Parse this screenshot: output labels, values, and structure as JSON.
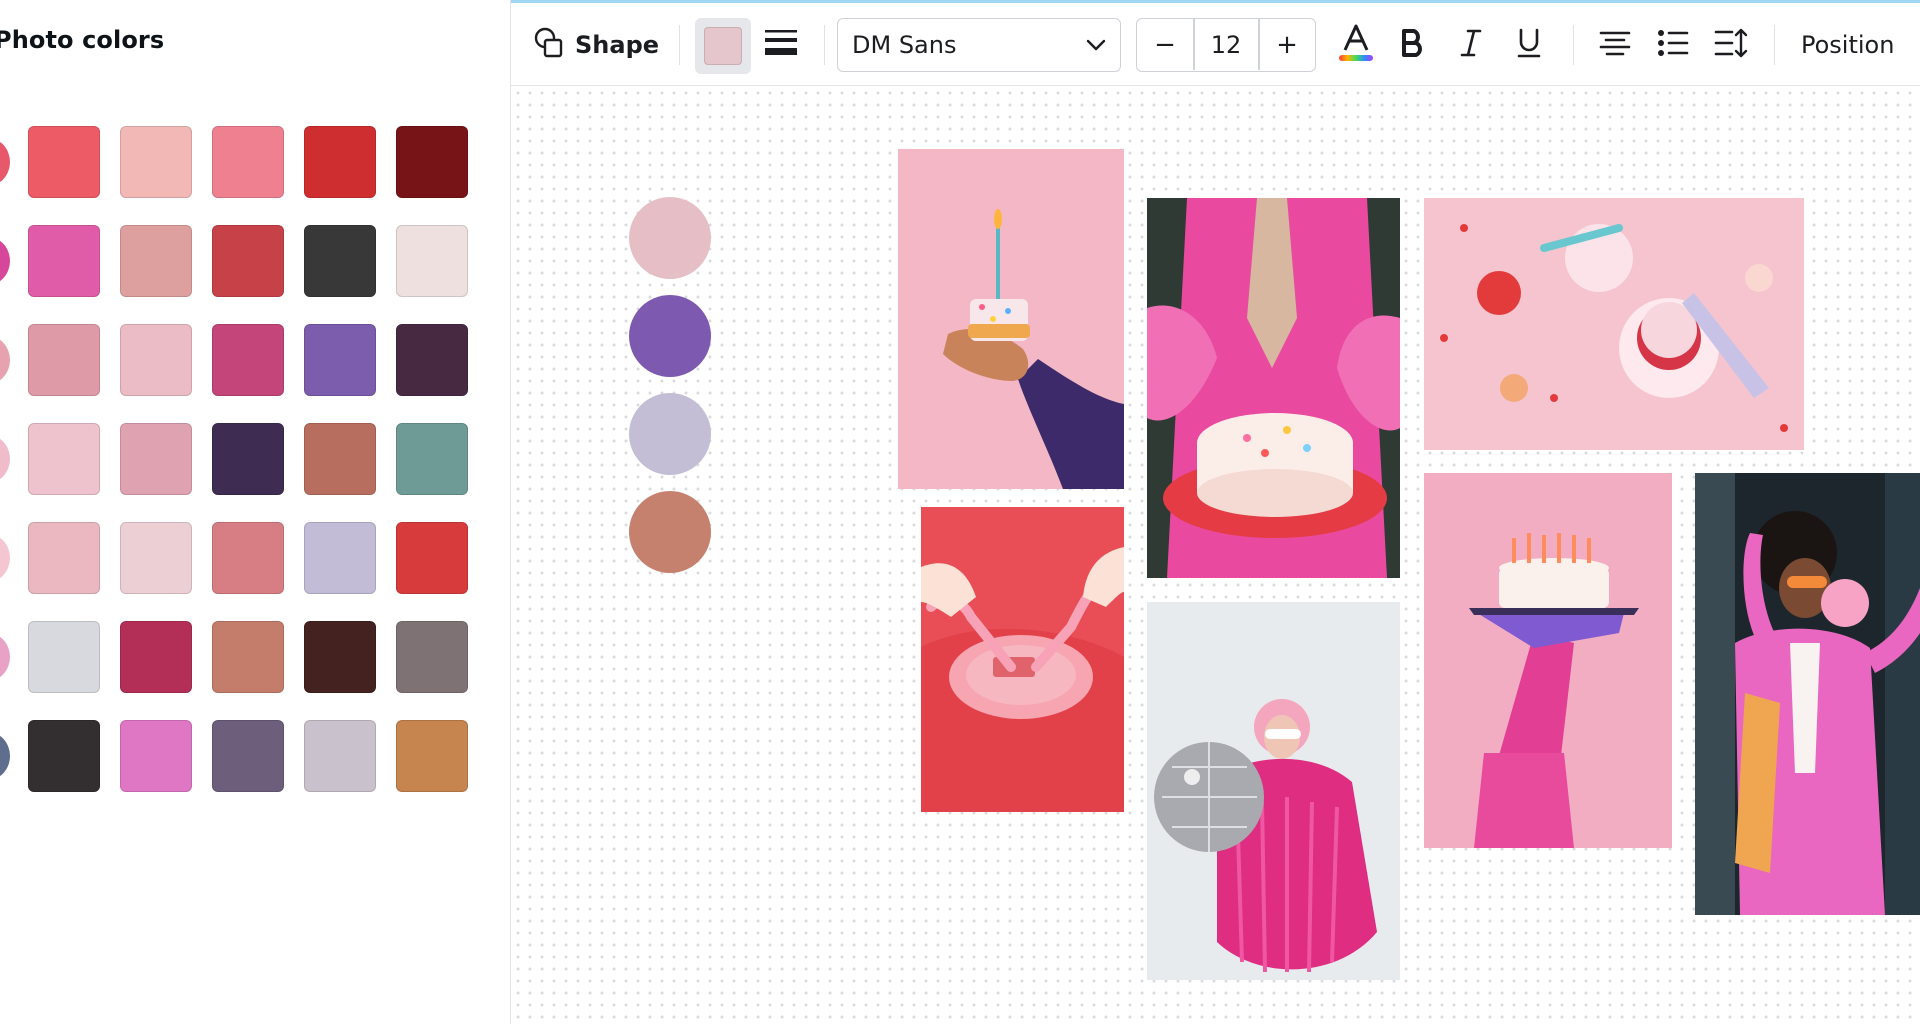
{
  "panel": {
    "title": "Photo colors",
    "palette_rows": [
      {
        "thumb": "#e7596a",
        "colors": [
          "#ec5b66",
          "#f2b8b6",
          "#ef8090",
          "#cf2e30",
          "#761418"
        ]
      },
      {
        "thumb": "#d6479a",
        "colors": [
          "#e05ca8",
          "#dea09f",
          "#c74149",
          "#383838",
          "#ede0df"
        ]
      },
      {
        "thumb": "#e7a2b0",
        "colors": [
          "#df9aa8",
          "#ecbcc6",
          "#c4457a",
          "#7c5cac",
          "#472a42"
        ]
      },
      {
        "thumb": "#f0bccb",
        "colors": [
          "#eec3cd",
          "#dfa2b1",
          "#3f2c52",
          "#b86e5e",
          "#6e9b95"
        ]
      },
      {
        "thumb": "#f4c6d2",
        "colors": [
          "#ebb8c1",
          "#ebcfd4",
          "#d77d84",
          "#c3bcd7",
          "#d73b3c"
        ]
      },
      {
        "thumb": "#e7a2c6",
        "colors": [
          "#d8d9de",
          "#b42f58",
          "#c37d6a",
          "#43221f",
          "#7e7274"
        ]
      },
      {
        "thumb": "#5e6e8c",
        "colors": [
          "#332f30",
          "#df77c5",
          "#6d5f7b",
          "#c9c1cb",
          "#c6844f"
        ]
      }
    ]
  },
  "toolbar": {
    "shape_label": "Shape",
    "current_fill": "#e6c6cd",
    "font_name": "DM Sans",
    "font_size": "12",
    "decrease_label": "−",
    "increase_label": "+",
    "position_label": "Position"
  },
  "canvas": {
    "palette_dots": [
      "#e6bec6",
      "#7e59b0",
      "#c3bdd6",
      "#c5806e"
    ]
  }
}
